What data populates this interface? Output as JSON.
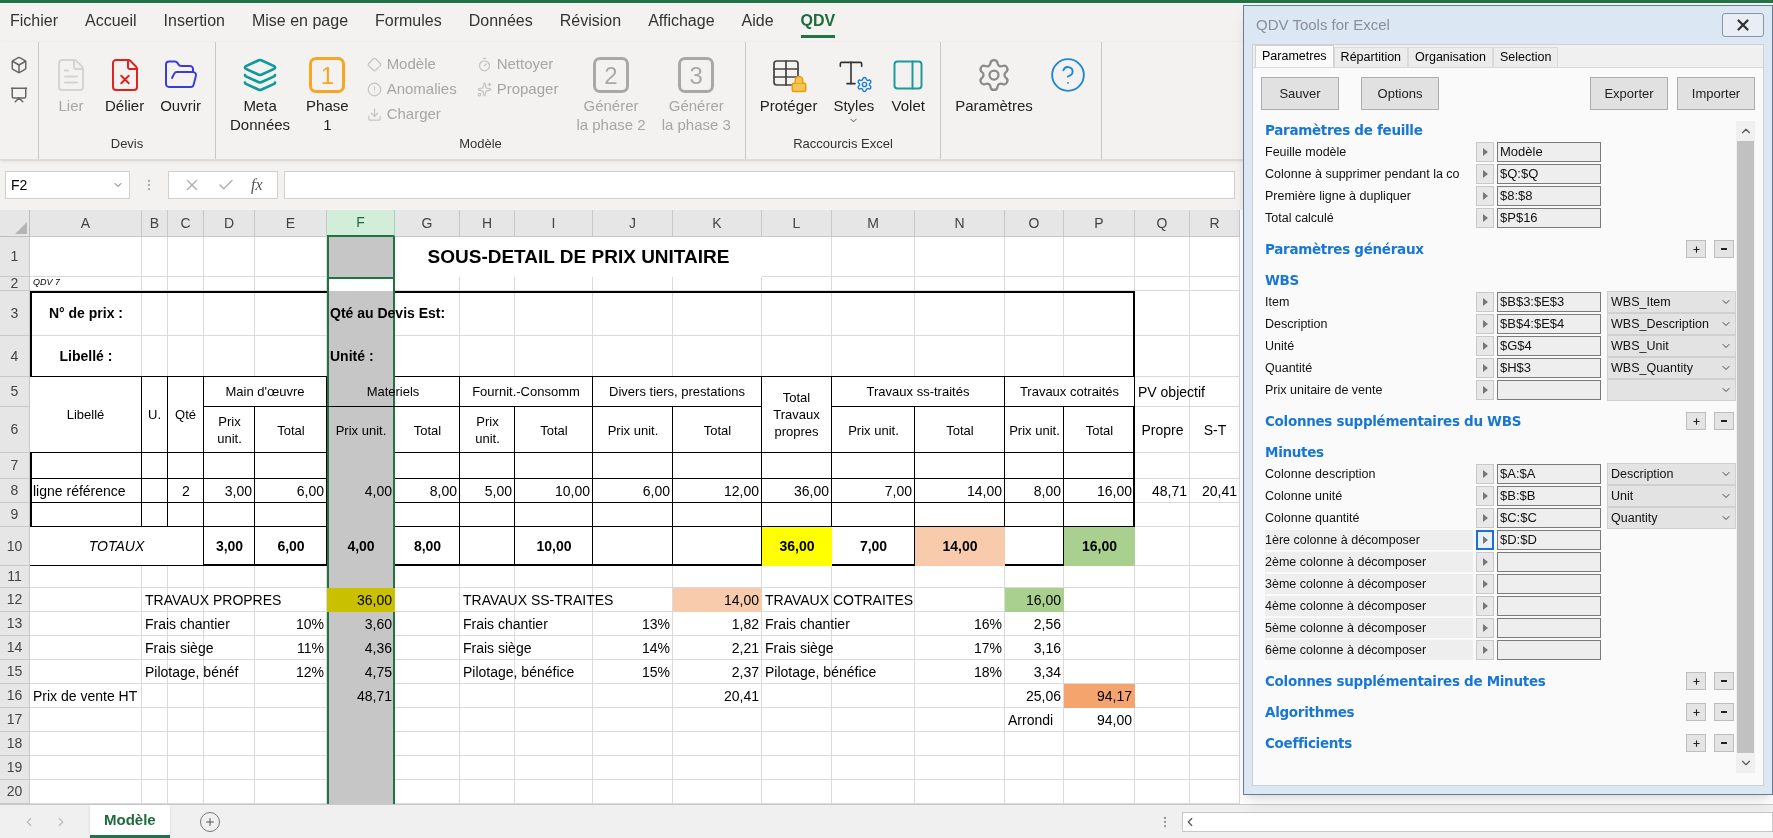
{
  "menu_tabs": [
    {
      "label": "Fichier",
      "selected": false
    },
    {
      "label": "Accueil",
      "selected": false
    },
    {
      "label": "Insertion",
      "selected": false
    },
    {
      "label": "Mise en page",
      "selected": false
    },
    {
      "label": "Formules",
      "selected": false
    },
    {
      "label": "Données",
      "selected": false
    },
    {
      "label": "Révision",
      "selected": false
    },
    {
      "label": "Affichage",
      "selected": false
    },
    {
      "label": "Aide",
      "selected": false
    },
    {
      "label": "QDV",
      "selected": true
    }
  ],
  "ribbon": {
    "groups": [
      {
        "buttons": [
          {
            "kind": "mini",
            "disabled": false
          },
          {
            "kind": "mini",
            "disabled": false
          }
        ]
      },
      {
        "label": "Devis",
        "buttons": [
          {
            "kind": "large",
            "lines": [
              "Lier"
            ],
            "disabled": true
          },
          {
            "kind": "large",
            "lines": [
              "Délier"
            ],
            "disabled": false
          },
          {
            "kind": "large",
            "lines": [
              "Ouvrir"
            ],
            "disabled": false
          }
        ]
      },
      {
        "label": "Modèle",
        "buttons": [
          {
            "kind": "large",
            "lines": [
              "Meta",
              "Données"
            ],
            "disabled": false
          },
          {
            "kind": "numbered",
            "badge": "1",
            "lines": [
              "Phase",
              "1"
            ],
            "disabled": false
          },
          {
            "kind": "small",
            "label": "Modèle",
            "disabled": true
          },
          {
            "kind": "small",
            "label": "Anomalies",
            "disabled": true
          },
          {
            "kind": "small",
            "label": "Charger",
            "disabled": true
          },
          {
            "kind": "small",
            "label": "Nettoyer",
            "disabled": true
          },
          {
            "kind": "small",
            "label": "Propager",
            "disabled": true
          },
          {
            "kind": "numbered",
            "badge": "2",
            "lines": [
              "Générer",
              "la phase 2"
            ],
            "disabled": true
          },
          {
            "kind": "numbered",
            "badge": "3",
            "lines": [
              "Générer",
              "la phase 3"
            ],
            "disabled": true
          }
        ]
      },
      {
        "label": "Raccourcis Excel",
        "buttons": [
          {
            "kind": "large",
            "lines": [
              "Protéger"
            ],
            "disabled": false
          },
          {
            "kind": "menu",
            "lines": [
              "Styles"
            ],
            "disabled": false
          },
          {
            "kind": "large",
            "lines": [
              "Volet"
            ],
            "disabled": false
          }
        ]
      },
      {
        "buttons": [
          {
            "kind": "large",
            "lines": [
              "Paramètres"
            ],
            "disabled": false
          },
          {
            "kind": "icon",
            "disabled": false
          }
        ]
      }
    ]
  },
  "formula_bar": {
    "name_box": "F2",
    "function_label": "fx"
  },
  "sheet": {
    "columns": [
      {
        "label": "A",
        "selected": false
      },
      {
        "label": "B",
        "selected": false
      },
      {
        "label": "C",
        "selected": false
      },
      {
        "label": "D",
        "selected": false
      },
      {
        "label": "E",
        "selected": false
      },
      {
        "label": "F",
        "selected": true
      },
      {
        "label": "G",
        "selected": false
      },
      {
        "label": "H",
        "selected": false
      },
      {
        "label": "I",
        "selected": false
      },
      {
        "label": "J",
        "selected": false
      },
      {
        "label": "K",
        "selected": false
      },
      {
        "label": "L",
        "selected": false
      },
      {
        "label": "M",
        "selected": false
      },
      {
        "label": "N",
        "selected": false
      },
      {
        "label": "O",
        "selected": false
      },
      {
        "label": "P",
        "selected": false
      },
      {
        "label": "Q",
        "selected": false
      },
      {
        "label": "R",
        "selected": false
      }
    ],
    "rows": [
      {
        "number": "1",
        "cells": [
          null,
          null,
          null,
          null,
          null,
          null,
          {
            "kind": "title",
            "text": "SOUS-DETAIL DE PRIX UNITAIRE"
          }
        ]
      },
      {
        "number": "2",
        "cells": [
          {
            "kind": "note",
            "text": "QDV 7"
          }
        ]
      },
      {
        "number": "3",
        "cells": [
          {
            "kind": "fieldlabel",
            "text": "N° de prix :"
          },
          null,
          null,
          null,
          null,
          {
            "kind": "inlinelabel",
            "text": "Qté au Devis Est:"
          }
        ]
      },
      {
        "number": "4",
        "cells": [
          {
            "kind": "fieldlabel",
            "text": "Libellé :"
          },
          null,
          null,
          null,
          null,
          {
            "kind": "inlinelabel",
            "text": "Unité :"
          }
        ]
      },
      {
        "number": "5",
        "cells": [
          {
            "kind": "tallheader",
            "text": "Libellé"
          },
          {
            "kind": "tallheader",
            "text": "U."
          },
          {
            "kind": "tallheader",
            "text": "Qté"
          },
          {
            "kind": "pairheader",
            "text": "Main d'œuvre"
          },
          null,
          {
            "kind": "pairheader",
            "text": "Materiels"
          },
          null,
          {
            "kind": "pairheader",
            "text": "Fournit.-Consomm"
          },
          null,
          {
            "kind": "pairheader",
            "text": "Divers tiers, prestations"
          },
          null,
          {
            "kind": "tallheader",
            "text": "Total Travaux propres"
          },
          {
            "kind": "pairheader",
            "text": "Travaux ss-traités"
          },
          null,
          {
            "kind": "pairheader",
            "text": "Travaux cotraités"
          },
          null,
          {
            "kind": "text",
            "text": "PV objectif"
          }
        ]
      },
      {
        "number": "6",
        "cells": [
          null,
          null,
          null,
          {
            "kind": "header",
            "text": "Prix unit."
          },
          {
            "kind": "header",
            "text": "Total"
          },
          {
            "kind": "header",
            "text": "Prix unit."
          },
          {
            "kind": "header",
            "text": "Total"
          },
          {
            "kind": "header",
            "text": "Prix unit."
          },
          {
            "kind": "header",
            "text": "Total"
          },
          {
            "kind": "header",
            "text": "Prix unit."
          },
          {
            "kind": "header",
            "text": "Total"
          },
          null,
          {
            "kind": "header",
            "text": "Prix unit."
          },
          {
            "kind": "header",
            "text": "Total"
          },
          {
            "kind": "header",
            "text": "Prix unit."
          },
          {
            "kind": "header",
            "text": "Total"
          },
          {
            "kind": "plainheader",
            "text": "Propre"
          },
          {
            "kind": "plainheader",
            "text": "S-T"
          }
        ]
      },
      {
        "number": "7"
      },
      {
        "number": "8",
        "cells": [
          {
            "kind": "text",
            "text": "ligne référence"
          },
          null,
          {
            "kind": "center",
            "text": "2"
          },
          {
            "kind": "number",
            "text": "3,00"
          },
          {
            "kind": "number",
            "text": "6,00"
          },
          {
            "kind": "number",
            "text": "4,00"
          },
          {
            "kind": "number",
            "text": "8,00"
          },
          {
            "kind": "number",
            "text": "5,00"
          },
          {
            "kind": "number",
            "text": "10,00"
          },
          {
            "kind": "number",
            "text": "6,00"
          },
          {
            "kind": "number",
            "text": "12,00"
          },
          {
            "kind": "number",
            "text": "36,00"
          },
          {
            "kind": "number",
            "text": "7,00"
          },
          {
            "kind": "number",
            "text": "14,00"
          },
          {
            "kind": "number",
            "text": "8,00"
          },
          {
            "kind": "number",
            "text": "16,00"
          },
          {
            "kind": "number",
            "text": "48,71"
          },
          {
            "kind": "number",
            "text": "20,41"
          }
        ]
      },
      {
        "number": "9"
      },
      {
        "number": "10",
        "cells": [
          {
            "kind": "totallabel",
            "text": "TOTAUX"
          },
          null,
          null,
          {
            "kind": "total",
            "text": "3,00"
          },
          {
            "kind": "total",
            "text": "6,00"
          },
          {
            "kind": "total",
            "text": "4,00"
          },
          {
            "kind": "total",
            "text": "8,00"
          },
          null,
          {
            "kind": "total",
            "text": "10,00"
          },
          null,
          null,
          {
            "kind": "total",
            "text": "36,00",
            "color": "#ffff00"
          },
          {
            "kind": "total",
            "text": "7,00"
          },
          {
            "kind": "total",
            "text": "14,00",
            "color": "#f8cbad"
          },
          null,
          {
            "kind": "total",
            "text": "16,00",
            "color": "#a9d08e"
          }
        ]
      },
      {
        "number": "11"
      },
      {
        "number": "12",
        "cells": [
          null,
          {
            "kind": "text",
            "text": "TRAVAUX PROPRES"
          },
          null,
          null,
          null,
          {
            "kind": "number",
            "text": "36,00",
            "color": "#c9c000"
          },
          null,
          {
            "kind": "text",
            "text": "TRAVAUX SS-TRAITES"
          },
          null,
          null,
          {
            "kind": "number",
            "text": "14,00",
            "color": "#f8cbad"
          },
          {
            "kind": "text",
            "text": "TRAVAUX COTRAITES"
          },
          null,
          null,
          {
            "kind": "number",
            "text": "16,00",
            "color": "#a9d08e"
          }
        ]
      },
      {
        "number": "13",
        "cells": [
          null,
          {
            "kind": "text",
            "text": "Frais chantier"
          },
          null,
          null,
          {
            "kind": "number",
            "text": "10%"
          },
          {
            "kind": "number",
            "text": "3,60"
          },
          null,
          {
            "kind": "text",
            "text": "Frais chantier"
          },
          null,
          {
            "kind": "number",
            "text": "13%"
          },
          {
            "kind": "number",
            "text": "1,82"
          },
          {
            "kind": "text",
            "text": "Frais chantier"
          },
          null,
          {
            "kind": "number",
            "text": "16%"
          },
          {
            "kind": "number",
            "text": "2,56"
          }
        ]
      },
      {
        "number": "14",
        "cells": [
          null,
          {
            "kind": "text",
            "text": "Frais siège"
          },
          null,
          null,
          {
            "kind": "number",
            "text": "11%"
          },
          {
            "kind": "number",
            "text": "4,36"
          },
          null,
          {
            "kind": "text",
            "text": "Frais siège"
          },
          null,
          {
            "kind": "number",
            "text": "14%"
          },
          {
            "kind": "number",
            "text": "2,21"
          },
          {
            "kind": "text",
            "text": "Frais siège"
          },
          null,
          {
            "kind": "number",
            "text": "17%"
          },
          {
            "kind": "number",
            "text": "3,16"
          }
        ]
      },
      {
        "number": "15",
        "cells": [
          null,
          {
            "kind": "text",
            "text": "Pilotage, bénéf"
          },
          null,
          null,
          {
            "kind": "number",
            "text": "12%"
          },
          {
            "kind": "number",
            "text": "4,75"
          },
          null,
          {
            "kind": "text",
            "text": "Pilotage, bénéfice"
          },
          null,
          {
            "kind": "number",
            "text": "15%"
          },
          {
            "kind": "number",
            "text": "2,37"
          },
          {
            "kind": "text",
            "text": "Pilotage, bénéfice"
          },
          null,
          {
            "kind": "number",
            "text": "18%"
          },
          {
            "kind": "number",
            "text": "3,34"
          }
        ]
      },
      {
        "number": "16",
        "cells": [
          {
            "kind": "text",
            "text": "Prix de vente HT"
          },
          null,
          null,
          null,
          null,
          {
            "kind": "number",
            "text": "48,71"
          },
          null,
          null,
          null,
          null,
          {
            "kind": "number",
            "text": "20,41"
          },
          null,
          null,
          null,
          {
            "kind": "number",
            "text": "25,06"
          },
          {
            "kind": "number",
            "text": "94,17",
            "color": "#f4a46c"
          }
        ]
      },
      {
        "number": "17",
        "cells": [
          null,
          null,
          null,
          null,
          null,
          null,
          null,
          null,
          null,
          null,
          null,
          null,
          null,
          null,
          {
            "kind": "text",
            "text": "Arrondi"
          },
          {
            "kind": "number",
            "text": "94,00"
          }
        ]
      },
      {
        "number": "18"
      },
      {
        "number": "19"
      },
      {
        "number": "20"
      }
    ]
  },
  "sheet_tabs": [
    {
      "label": "Modèle",
      "selected": true
    }
  ],
  "panel": {
    "title": "QDV Tools for Excel",
    "tabs": [
      {
        "label": "Parametres",
        "selected": true
      },
      {
        "label": "Répartition",
        "selected": false
      },
      {
        "label": "Organisation",
        "selected": false
      },
      {
        "label": "Selection",
        "selected": false
      }
    ],
    "buttons": [
      {
        "label": "Sauver",
        "kind": "left"
      },
      {
        "label": "Options",
        "kind": "left"
      },
      {
        "label": "Exporter",
        "kind": "right"
      },
      {
        "label": "Importer",
        "kind": "right"
      }
    ],
    "sections": [
      {
        "title": "Paramètres de feuille",
        "expandable": false,
        "rows": [
          {
            "kind": "field",
            "label": "Feuille modèle",
            "value": "Modèle"
          },
          {
            "kind": "field",
            "label": "Colonne à supprimer pendant la co",
            "value": "$Q:$Q"
          },
          {
            "kind": "field",
            "label": "Première ligne à dupliquer",
            "value": "$8:$8"
          },
          {
            "kind": "field",
            "label": "Total calculé",
            "value": "$P$16"
          }
        ]
      },
      {
        "title": "Paramètres généraux",
        "expandable": true
      },
      {
        "title": "WBS",
        "expandable": false,
        "rows": [
          {
            "kind": "select",
            "label": "Item",
            "value": "$B$3:$E$3",
            "option": "WBS_Item"
          },
          {
            "kind": "select",
            "label": "Description",
            "value": "$B$4:$E$4",
            "option": "WBS_Description"
          },
          {
            "kind": "select",
            "label": "Unité",
            "value": "$G$4",
            "option": "WBS_Unit"
          },
          {
            "kind": "select",
            "label": "Quantité",
            "value": "$H$3",
            "option": "WBS_Quantity"
          },
          {
            "kind": "select",
            "label": "Prix unitaire de vente"
          }
        ]
      },
      {
        "title": "Colonnes supplémentaires du WBS",
        "expandable": true
      },
      {
        "title": "Minutes",
        "expandable": false,
        "rows": [
          {
            "kind": "select",
            "label": "Colonne description",
            "value": "$A:$A",
            "option": "Description"
          },
          {
            "kind": "select",
            "label": "Colonne unité",
            "value": "$B:$B",
            "option": "Unit"
          },
          {
            "kind": "select",
            "label": "Colonne quantité",
            "value": "$C:$C",
            "option": "Quantity"
          },
          {
            "kind": "decompose",
            "label": "1ère colonne à décomposer",
            "value": "$D:$D",
            "focused": true
          },
          {
            "kind": "decompose",
            "label": "2ème colonne à décomposer",
            "focused": false
          },
          {
            "kind": "decompose",
            "label": "3ème colonne à décomposer",
            "focused": false
          },
          {
            "kind": "decompose",
            "label": "4ème colonne à décomposer",
            "focused": false
          },
          {
            "kind": "decompose",
            "label": "5ème colonne à décomposer",
            "focused": false
          },
          {
            "kind": "decompose",
            "label": "6ème colonne à décomposer",
            "focused": false
          }
        ]
      },
      {
        "title": "Colonnes supplémentaires de Minutes",
        "expandable": true
      },
      {
        "title": "Algorithmes",
        "expandable": true
      },
      {
        "title": "Coefficients",
        "expandable": true
      }
    ]
  }
}
